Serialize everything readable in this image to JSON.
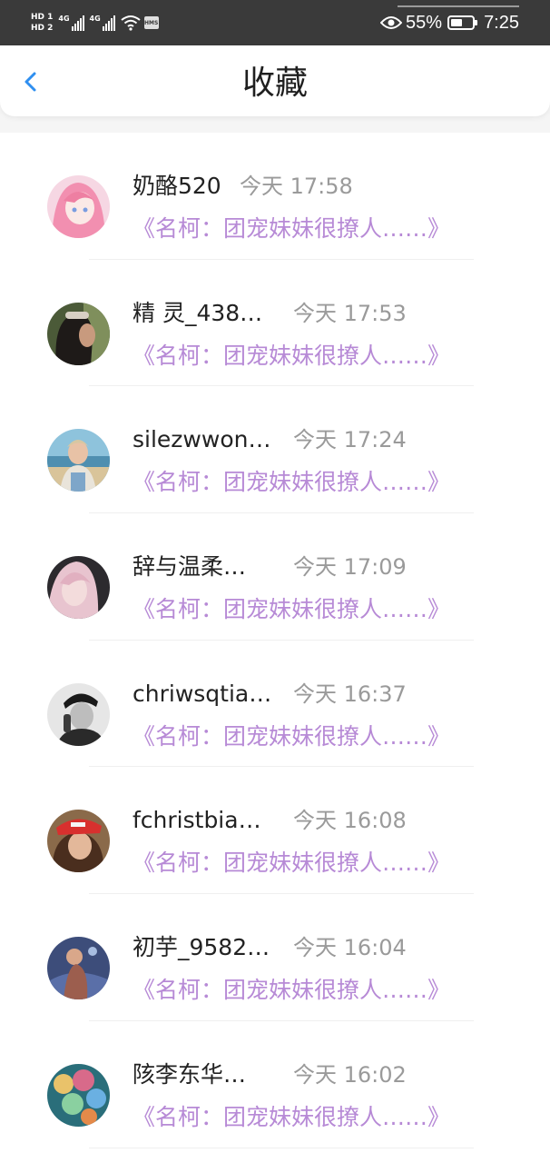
{
  "status_bar": {
    "sim1": "HD 1",
    "sim2": "HD 2",
    "net1": "4G",
    "net2": "4G",
    "hms": "HMS",
    "battery_percent": "55%",
    "battery_level": 0.55,
    "clock": "7:25"
  },
  "header": {
    "title": "收藏",
    "back_icon": "chevron-left-icon"
  },
  "colors": {
    "accent": "#2f8ff0",
    "snippet": "#b78ad6",
    "time": "#9a9a9a",
    "status_bar_bg": "#3a3a3a"
  },
  "items": [
    {
      "name": "奶酪520",
      "time": "今天 17:58",
      "snippet": "《名柯：团宠妹妹很撩人……》"
    },
    {
      "name": "精 灵_438…",
      "time": "今天 17:53",
      "snippet": "《名柯：团宠妹妹很撩人……》"
    },
    {
      "name": "silezwwon…",
      "time": "今天 17:24",
      "snippet": "《名柯：团宠妹妹很撩人……》"
    },
    {
      "name": "辞与温柔…",
      "time": "今天 17:09",
      "snippet": "《名柯：团宠妹妹很撩人……》"
    },
    {
      "name": "chriwsqtia…",
      "time": "今天 16:37",
      "snippet": "《名柯：团宠妹妹很撩人……》"
    },
    {
      "name": "fchristbia…",
      "time": "今天 16:08",
      "snippet": "《名柯：团宠妹妹很撩人……》"
    },
    {
      "name": "初芋_9582…",
      "time": "今天 16:04",
      "snippet": "《名柯：团宠妹妹很撩人……》"
    },
    {
      "name": "陔李东华…",
      "time": "今天 16:02",
      "snippet": "《名柯：团宠妹妹很撩人……》"
    }
  ]
}
